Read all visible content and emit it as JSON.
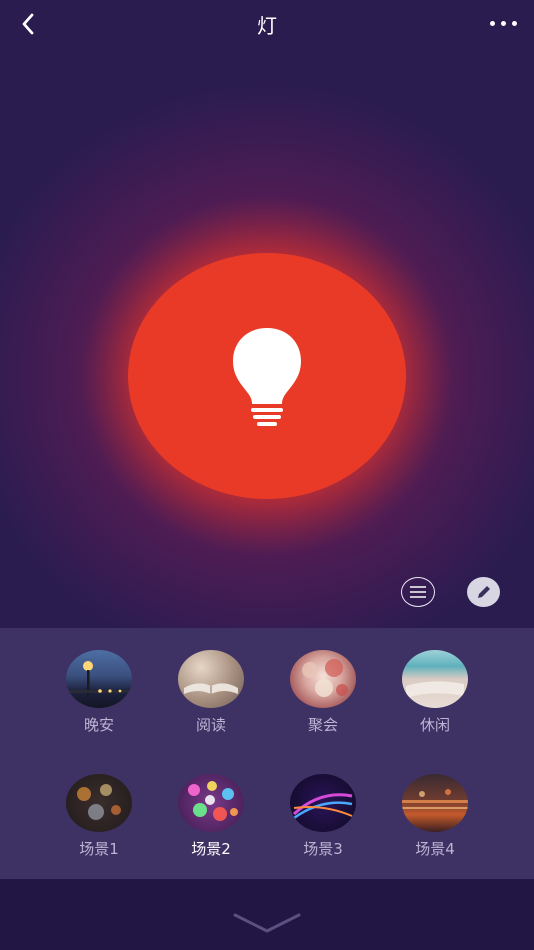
{
  "header": {
    "title": "灯",
    "back_icon": "back-arrow-icon",
    "more_icon": "more-dots-icon"
  },
  "power": {
    "state": "on",
    "color": "#e83a27",
    "icon": "lightbulb-icon"
  },
  "actions": {
    "menu_icon": "list-icon",
    "edit_icon": "pencil-icon"
  },
  "scenes": {
    "row1": [
      {
        "label": "晚安",
        "icon": "night-street-lamp"
      },
      {
        "label": "阅读",
        "icon": "open-book"
      },
      {
        "label": "聚会",
        "icon": "party-balloons"
      },
      {
        "label": "休闲",
        "icon": "beach"
      }
    ],
    "row2": [
      {
        "label": "场景1",
        "icon": "bokeh-lights"
      },
      {
        "label": "场景2",
        "icon": "colorful-sparkles",
        "active": true
      },
      {
        "label": "场景3",
        "icon": "light-streaks"
      },
      {
        "label": "场景4",
        "icon": "city-lights"
      }
    ]
  },
  "footer": {
    "collapse_icon": "chevron-down-icon"
  }
}
